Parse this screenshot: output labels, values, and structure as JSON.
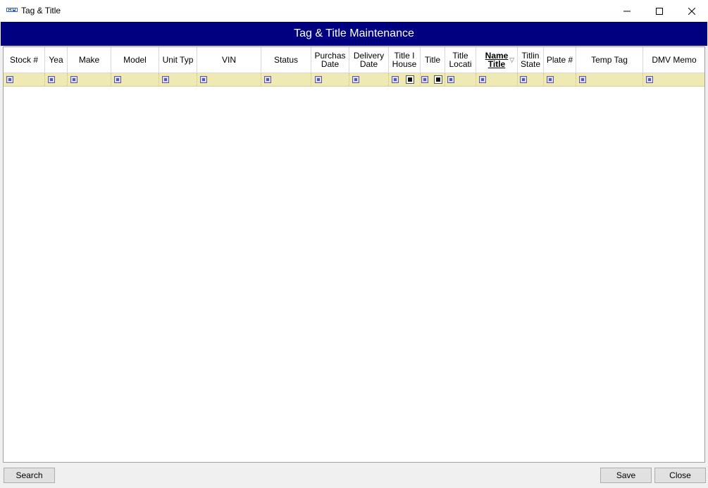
{
  "window": {
    "title": "Tag & Title",
    "app_icon": "app-logo-icon",
    "controls": [
      "minimize-icon",
      "maximize-icon",
      "close-icon"
    ]
  },
  "banner": {
    "title": "Tag & Title Maintenance",
    "color": "#000080"
  },
  "grid": {
    "columns": [
      {
        "label": "Stock #"
      },
      {
        "label": "Yea"
      },
      {
        "label": "Make"
      },
      {
        "label": "Model"
      },
      {
        "label": "Unit Typ"
      },
      {
        "label": "VIN"
      },
      {
        "label": "Status"
      },
      {
        "label": "Purchas\nDate"
      },
      {
        "label": "Delivery\nDate"
      },
      {
        "label": "Title I\nHouse"
      },
      {
        "label": "Title"
      },
      {
        "label": "Title\nLocati"
      },
      {
        "label": "Name\nTitle",
        "sorted": true,
        "sort_icon": "sort-descending-icon"
      },
      {
        "label": "Titlin\nState"
      },
      {
        "label": "Plate #"
      },
      {
        "label": "Temp Tag"
      },
      {
        "label": "DMV Memo"
      }
    ],
    "filter_row_color": "#efe9b4",
    "filter_icon": "filter-operator-icon",
    "checkbox_filter_columns": [
      "Title I\nHouse",
      "Title"
    ]
  },
  "buttons": {
    "search": "Search",
    "save": "Save",
    "close": "Close"
  }
}
